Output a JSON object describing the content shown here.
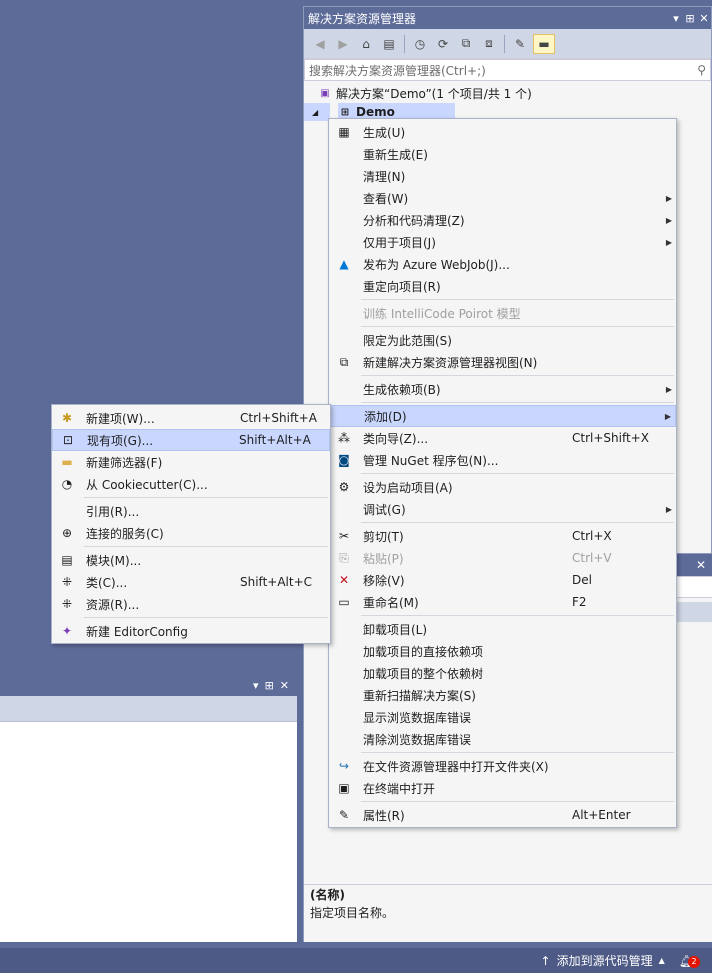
{
  "solution_explorer": {
    "title": "解决方案资源管理器",
    "title_controls": [
      "▾",
      "⊞",
      "✕"
    ],
    "search_placeholder": "搜索解决方案资源管理器(Ctrl+;)",
    "solution_label": "解决方案“Demo”(1 个项目/共 1 个)",
    "project_label": "Demo"
  },
  "context_menu": {
    "items": [
      {
        "label": "生成(U)",
        "icon": "build-icon"
      },
      {
        "label": "重新生成(E)"
      },
      {
        "label": "清理(N)"
      },
      {
        "label": "查看(W)",
        "arrow": true
      },
      {
        "label": "分析和代码清理(Z)",
        "arrow": true
      },
      {
        "label": "仅用于项目(J)",
        "arrow": true
      },
      {
        "label": "发布为 Azure WebJob(J)...",
        "icon": "azure-icon"
      },
      {
        "label": "重定向项目(R)"
      },
      {
        "label": "训练 IntelliCode Poirot 模型",
        "disabled": true
      },
      {
        "label": "限定为此范围(S)"
      },
      {
        "label": "新建解决方案资源管理器视图(N)",
        "icon": "new-view-icon"
      },
      {
        "label": "生成依赖项(B)",
        "arrow": true
      },
      {
        "label": "添加(D)",
        "arrow": true,
        "highlighted": true
      },
      {
        "label": "类向导(Z)...",
        "shortcut": "Ctrl+Shift+X",
        "icon": "class-wizard-icon"
      },
      {
        "label": "管理 NuGet 程序包(N)...",
        "icon": "nuget-icon"
      },
      {
        "label": "设为启动项目(A)",
        "icon": "gear-icon"
      },
      {
        "label": "调试(G)",
        "arrow": true
      },
      {
        "label": "剪切(T)",
        "shortcut": "Ctrl+X",
        "icon": "scissors-icon"
      },
      {
        "label": "粘贴(P)",
        "shortcut": "Ctrl+V",
        "disabled": true,
        "icon": "paste-icon"
      },
      {
        "label": "移除(V)",
        "shortcut": "Del",
        "icon": "remove-icon"
      },
      {
        "label": "重命名(M)",
        "shortcut": "F2",
        "icon": "rename-icon"
      },
      {
        "label": "卸载项目(L)"
      },
      {
        "label": "加载项目的直接依赖项"
      },
      {
        "label": "加载项目的整个依赖树"
      },
      {
        "label": "重新扫描解决方案(S)"
      },
      {
        "label": "显示浏览数据库错误"
      },
      {
        "label": "清除浏览数据库错误"
      },
      {
        "label": "在文件资源管理器中打开文件夹(X)",
        "icon": "open-folder-icon"
      },
      {
        "label": "在终端中打开",
        "icon": "terminal-icon"
      },
      {
        "label": "属性(R)",
        "shortcut": "Alt+Enter",
        "icon": "wrench-icon"
      }
    ]
  },
  "submenu": {
    "items": [
      {
        "label": "新建项(W)...",
        "shortcut": "Ctrl+Shift+A",
        "icon": "new-item-icon"
      },
      {
        "label": "现有项(G)...",
        "shortcut": "Shift+Alt+A",
        "icon": "existing-item-icon",
        "highlighted": true
      },
      {
        "label": "新建筛选器(F)",
        "icon": "filter-folder-icon"
      },
      {
        "label": "从 Cookiecutter(C)...",
        "icon": "cookiecutter-icon"
      },
      {
        "label": "引用(R)..."
      },
      {
        "label": "连接的服务(C)",
        "icon": "connected-service-icon"
      },
      {
        "label": "模块(M)...",
        "icon": "module-icon"
      },
      {
        "label": "类(C)...",
        "shortcut": "Shift+Alt+C",
        "icon": "class-icon"
      },
      {
        "label": "资源(R)...",
        "icon": "resource-icon"
      },
      {
        "label": "新建 EditorConfig",
        "icon": "editorconfig-icon"
      }
    ]
  },
  "properties": {
    "name_heading": "(名称)",
    "name_desc": "指定项目名称。"
  },
  "status_bar": {
    "source_control": "添加到源代码管理",
    "notifications": "2"
  },
  "colors": {
    "background": "#5d6b99",
    "menu_highlight": "#c9d7ff",
    "status_bar": "#4d5a85"
  }
}
